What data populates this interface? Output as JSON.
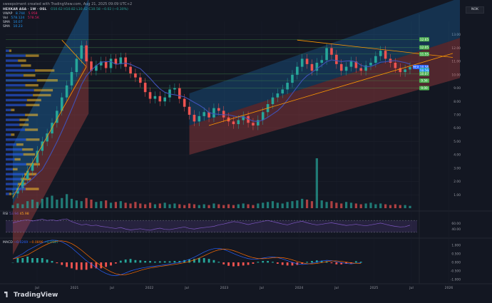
{
  "caption": "sweepsiment created with TradingView.com, Aug 21, 2025 09:09 UTC+2",
  "legend": {
    "symbol": "HEXKAR ASA · 1W · OSL",
    "ohlc": "O10.62 H10.82 L10.42 C10.58 −0.02 (−0.30%)",
    "rows": [
      {
        "label": "VWAP",
        "v1": "8.744",
        "v2": "5.958"
      },
      {
        "label": "Vol",
        "v1": "578.124",
        "v2": "578.5K"
      },
      {
        "label": "SMA",
        "v1": "10.07",
        "v2": ""
      },
      {
        "label": "SMA",
        "v1": "10.23",
        "v2": ""
      }
    ]
  },
  "currency": "NOK",
  "logo": "TradingView",
  "rsi_label": {
    "name": "RSI",
    "v1": "53.94",
    "v2": "45.98"
  },
  "macd_label": {
    "name": "MACD",
    "v1": "−0.0269",
    "v2": "−0.0896",
    "v3": "−0.0587"
  },
  "chart_data": [
    {
      "type": "line",
      "title": "",
      "y_ticks": [
        "1.00",
        "2.00",
        "3.00",
        "4.00",
        "5.00",
        "6.00",
        "7.00",
        "8.00",
        "9.00",
        "10.00",
        "11.00",
        "12.00",
        "13.00"
      ],
      "x_ticks": [
        "Jul",
        "2021",
        "Jul",
        "2022",
        "Jul",
        "2023",
        "Jul",
        "2024",
        "Jul",
        "2025",
        "Jul",
        "2026"
      ],
      "price_labels": [
        {
          "text": "12.65",
          "color": "#4caf50"
        },
        {
          "text": "12.05",
          "color": "#4caf50"
        },
        {
          "text": "11.55",
          "color": "#4caf50"
        },
        {
          "text": "HEX 10.58",
          "color": "#2962ff"
        },
        {
          "text": "10.36",
          "color": "#26a69a"
        },
        {
          "text": "10.29",
          "color": "#2196f3"
        },
        {
          "text": "10.07",
          "color": "#4caf50"
        },
        {
          "text": "9.56",
          "color": "#4caf50"
        },
        {
          "text": "9.00",
          "color": "#4caf50"
        }
      ],
      "ylim": [
        0,
        14
      ],
      "price_series": [
        1.1,
        1.5,
        2.2,
        2.8,
        3.4,
        4.3,
        5.0,
        5.6,
        6.4,
        7.3,
        8.3,
        9.2,
        10.2,
        11.2,
        12.2,
        11.0,
        10.3,
        10.7,
        11.0,
        10.5,
        11.2,
        10.8,
        11.3,
        10.6,
        10.1,
        9.8,
        9.4,
        8.7,
        8.2,
        8.4,
        8.0,
        8.3,
        8.9,
        9.0,
        8.2,
        7.6,
        7.0,
        6.5,
        6.9,
        7.2,
        6.8,
        7.5,
        7.3,
        6.8,
        6.5,
        6.3,
        6.6,
        6.9,
        6.4,
        6.2,
        6.6,
        7.2,
        7.8,
        8.3,
        8.6,
        8.9,
        9.4,
        10.0,
        10.6,
        11.2,
        10.8,
        10.3,
        10.9,
        11.1,
        12.0,
        11.5,
        10.8,
        10.3,
        10.6,
        11.0,
        10.5,
        10.3,
        10.7,
        10.9,
        11.4,
        11.8,
        11.2,
        10.9,
        10.5,
        10.2,
        10.4,
        10.58
      ],
      "volume": [
        0.4,
        0.6,
        0.5,
        0.9,
        1.1,
        0.8,
        1.2,
        1.4,
        1.6,
        1.1,
        1.3,
        1.8,
        1.2,
        1.0,
        0.9,
        1.3,
        1.1,
        0.8,
        0.9,
        1.0,
        0.7,
        0.8,
        0.9,
        0.7,
        0.6,
        0.8,
        0.6,
        0.5,
        0.7,
        0.5,
        0.6,
        0.7,
        0.5,
        0.6,
        0.5,
        0.4,
        0.6,
        0.5,
        0.4,
        0.5,
        0.4,
        0.6,
        0.5,
        0.4,
        0.5,
        0.4,
        0.5,
        0.6,
        0.5,
        0.4,
        0.6,
        0.7,
        0.8,
        0.9,
        0.7,
        0.6,
        0.8,
        0.9,
        1.0,
        1.2,
        1.1,
        0.9,
        6.4,
        1.0,
        0.8,
        0.9,
        0.7,
        0.6,
        0.8,
        0.7,
        0.6,
        0.5,
        0.6,
        0.7,
        0.5,
        0.6,
        0.5,
        0.4,
        0.5,
        0.4,
        0.4,
        0.3
      ],
      "rsi": [
        62,
        66,
        70,
        72,
        68,
        71,
        74,
        70,
        72,
        69,
        73,
        75,
        66,
        60,
        55,
        57,
        52,
        54,
        50,
        48,
        45,
        43,
        46,
        41,
        38,
        40,
        42,
        39,
        37,
        41,
        44,
        40,
        39,
        42,
        45,
        48,
        43,
        41,
        44,
        46,
        48,
        50,
        55,
        58,
        62,
        66,
        64,
        60,
        56,
        60,
        63,
        67,
        70,
        66,
        62,
        58,
        55,
        60,
        64,
        67,
        62,
        58,
        55,
        57,
        60,
        62,
        59,
        56,
        53,
        55,
        57,
        54,
        52,
        55,
        58,
        61,
        57,
        53,
        50,
        48,
        49,
        53.94
      ],
      "rsi_levels": {
        "upper": 70,
        "lower": 30
      },
      "rsi_ticks": [
        "40.00",
        "60.00"
      ],
      "macd": [
        0.2,
        0.35,
        0.5,
        0.7,
        0.85,
        1.0,
        1.15,
        1.25,
        1.3,
        1.28,
        1.2,
        1.05,
        0.85,
        0.6,
        0.35,
        0.1,
        -0.1,
        -0.3,
        -0.5,
        -0.65,
        -0.75,
        -0.78,
        -0.72,
        -0.62,
        -0.5,
        -0.42,
        -0.35,
        -0.3,
        -0.25,
        -0.22,
        -0.18,
        -0.14,
        -0.1,
        -0.05,
        0.0,
        0.08,
        0.18,
        0.3,
        0.45,
        0.6,
        0.72,
        0.8,
        0.82,
        0.76,
        0.65,
        0.52,
        0.4,
        0.3,
        0.22,
        0.18,
        0.2,
        0.25,
        0.3,
        0.32,
        0.28,
        0.2,
        0.1,
        0.0,
        -0.08,
        -0.12,
        -0.1,
        -0.05,
        0.02,
        0.08,
        0.12,
        0.1,
        0.04,
        -0.02,
        -0.06,
        -0.09,
        -0.05,
        -0.0269
      ],
      "macd_ticks": [
        "1.000",
        "0.500",
        "0.000",
        "-0.500",
        "-1.000"
      ]
    }
  ]
}
